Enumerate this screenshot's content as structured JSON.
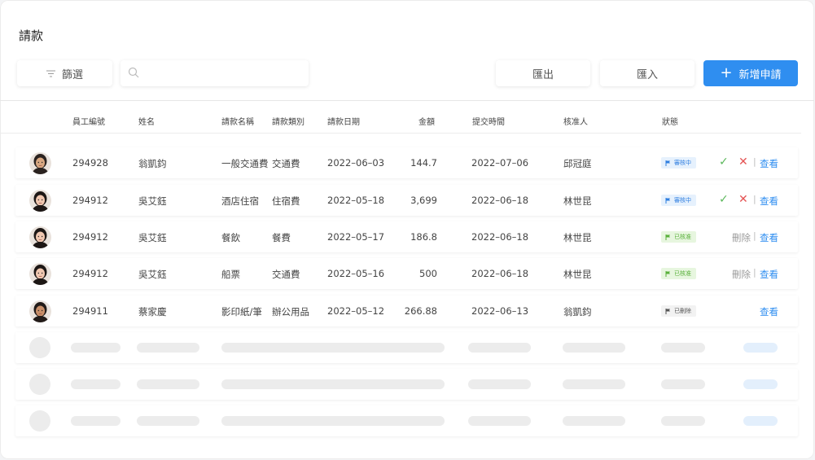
{
  "title": "請款",
  "toolbar": {
    "filter_label": "篩選",
    "search_placeholder": "",
    "export_label": "匯出",
    "import_label": "匯入",
    "new_label": "新增申請",
    "accent_color": "#2f8ef0"
  },
  "columns": [
    "員工編號",
    "姓名",
    "請款名稱",
    "請款類別",
    "請款日期",
    "金額",
    "提交時間",
    "核准人",
    "狀態"
  ],
  "rows": [
    {
      "emp_id": "294928",
      "name": "翁凱鈞",
      "item": "一般交通費",
      "category": "交通費",
      "date": "2022–06–03",
      "amount": "144.7",
      "submitted": "2022–07–06",
      "approver": "邱冠庭",
      "status": "審核中",
      "status_type": "pending",
      "actions": {
        "approve": "✓",
        "reject": "✕",
        "delete": "",
        "view": "查看"
      }
    },
    {
      "emp_id": "294912",
      "name": "吳艾鈺",
      "item": "酒店住宿",
      "category": "住宿費",
      "date": "2022–05–18",
      "amount": "3,699",
      "submitted": "2022–06–18",
      "approver": "林世昆",
      "status": "審核中",
      "status_type": "pending",
      "actions": {
        "approve": "✓",
        "reject": "✕",
        "delete": "",
        "view": "查看"
      }
    },
    {
      "emp_id": "294912",
      "name": "吳艾鈺",
      "item": "餐飲",
      "category": "餐費",
      "date": "2022–05–17",
      "amount": "186.8",
      "submitted": "2022–06–18",
      "approver": "林世昆",
      "status": "已核准",
      "status_type": "approved",
      "actions": {
        "approve": "",
        "reject": "",
        "delete": "刪除",
        "view": "查看"
      }
    },
    {
      "emp_id": "294912",
      "name": "吳艾鈺",
      "item": "船票",
      "category": "交通費",
      "date": "2022–05–16",
      "amount": "500",
      "submitted": "2022–06–18",
      "approver": "林世昆",
      "status": "已核准",
      "status_type": "approved",
      "actions": {
        "approve": "",
        "reject": "",
        "delete": "刪除",
        "view": "查看"
      }
    },
    {
      "emp_id": "294911",
      "name": "蔡家慶",
      "item": "影印紙/筆",
      "category": "辦公用品",
      "date": "2022–05–12",
      "amount": "266.88",
      "submitted": "2022–06–13",
      "approver": "翁凱鈞",
      "status": "已刪除",
      "status_type": "deleted",
      "actions": {
        "approve": "",
        "reject": "",
        "delete": "",
        "view": "查看"
      }
    }
  ],
  "skeleton_row_count": 3,
  "colors": {
    "pending": "#2f7ee0",
    "approved": "#58b03a",
    "deleted": "#555555",
    "approve_icon": "#5cb85c",
    "reject_icon": "#e45454"
  }
}
